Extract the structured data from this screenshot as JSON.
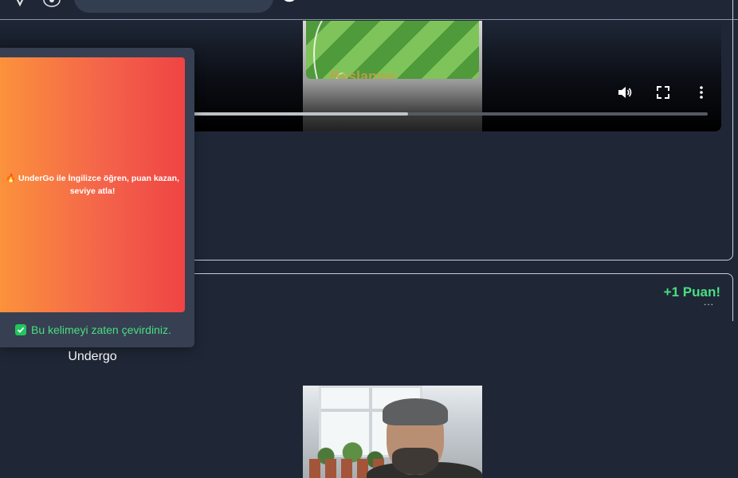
{
  "header": {
    "search_placeholder": "",
    "icons": [
      "filter-icon",
      "eye-icon",
      "help-circle-icon"
    ]
  },
  "video": {
    "watermark_text": "Baslangıç",
    "controls": [
      "volume-icon",
      "fullscreen-icon",
      "more-vert-icon"
    ],
    "progress_fraction": 0.577
  },
  "card": {
    "points_text": "+1 Puan!",
    "more_label": "..."
  },
  "word": {
    "text": "Undergo"
  },
  "popup": {
    "banner_text": "🔥 UnderGo ile İngilizce öğren, puan kazan, seviye atla!",
    "checkbox_label": "Bu kelimeyi zaten çevirdiniz.",
    "checkbox_checked": true
  },
  "colors": {
    "background": "#1f2737",
    "popup_bg": "#364052",
    "accent_green": "#4ade80",
    "banner_start": "#fb923c",
    "banner_end": "#ef4444"
  }
}
